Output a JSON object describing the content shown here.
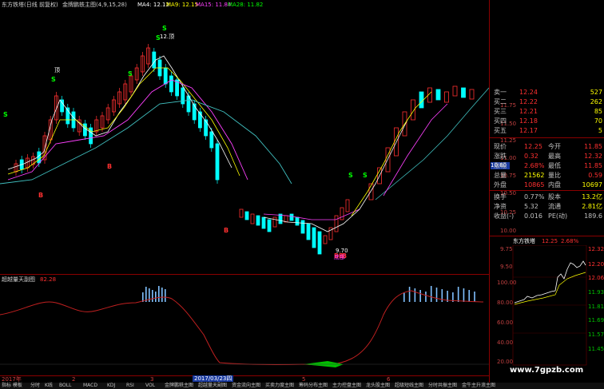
{
  "header": {
    "title": "东方铁塔(日线 前复权)",
    "indicator_name": "金牌鹏轶主图(4,9,15,28)",
    "ma4": "MA4: 12.12",
    "ma9": "MA9: 12.15",
    "ma15": "MA15: 11.84",
    "ma28": "MA28: 11.82"
  },
  "main_chart": {
    "annotations": {
      "top_label": "12.顶",
      "left_label": "顶",
      "low_label": "9.70",
      "low_bottom": "底部",
      "price_flag": "10.80"
    },
    "s_marks": [
      "S",
      "S",
      "S",
      "S",
      "S",
      "S",
      "S"
    ],
    "b_marks": [
      "B",
      "B",
      "B",
      "B",
      "B",
      "B"
    ],
    "price_ticks": [
      "11.75",
      "11.50",
      "11.25",
      "11.00",
      "10.75",
      "10.50",
      "10.25",
      "10.00",
      "9.75",
      "9.50"
    ]
  },
  "sub_chart": {
    "name": "超越量天副图",
    "value": "82.28",
    "ticks": [
      "100.00",
      "80.00",
      "60.00",
      "40.00",
      "20.00"
    ]
  },
  "order_book": {
    "rows": [
      {
        "label": "卖一",
        "price": "12.24",
        "vol": "527"
      },
      {
        "label": "买二",
        "price": "12.22",
        "vol": "262"
      },
      {
        "label": "买三",
        "price": "12.21",
        "vol": "85"
      },
      {
        "label": "买四",
        "price": "12.18",
        "vol": "70"
      },
      {
        "label": "买五",
        "price": "12.17",
        "vol": "5"
      }
    ]
  },
  "quote": {
    "rows": [
      {
        "l1": "现价",
        "v1": "12.25",
        "l2": "今开",
        "v2": "11.85"
      },
      {
        "l1": "涨跌",
        "v1": "0.32",
        "l2": "最高",
        "v2": "12.32"
      },
      {
        "l1": "涨幅",
        "v1": "2.68%",
        "l2": "最低",
        "v2": "11.85"
      },
      {
        "l1": "总量",
        "v1": "21562",
        "l2": "量比",
        "v2": "0.59"
      },
      {
        "l1": "外盘",
        "v1": "10865",
        "l2": "内盘",
        "v2": "10697"
      },
      {
        "l1": "换手",
        "v1": "0.77%",
        "l2": "股本",
        "v2": "13.2亿"
      },
      {
        "l1": "净资",
        "v1": "5.32",
        "l2": "流通",
        "v2": "2.81亿"
      },
      {
        "l1": "收益(-)",
        "v1": "0.016",
        "l2": "PE(动)",
        "v2": "189.6"
      }
    ]
  },
  "mini_chart": {
    "title": "东方铁塔",
    "price": "12.25",
    "pct": "2.68%",
    "right_ticks": [
      "12.32",
      "12.20",
      "12.06",
      "11.93",
      "11.81",
      "11.69",
      "11.57",
      "11.45"
    ]
  },
  "timeline": {
    "labels": [
      "2017年",
      "2",
      "3",
      "2017/03/23四",
      "5",
      "6"
    ]
  },
  "tabs": [
    "指标 模板",
    "分时",
    "K线",
    "BOLL",
    "MACD",
    "KDJ",
    "RSI",
    "VOL",
    "金牌鹏轶主图",
    "超越量天副图",
    "资金流向主图",
    "买卖力度主图",
    "筹码分布主图",
    "主力控盘主图",
    "龙头股主图",
    "超级短线主图",
    "分时共振主图",
    "金牛主升浪主图"
  ],
  "watermark": "www.7gpzb.com",
  "colors": {
    "up": "#ff3030",
    "down": "#00ffff",
    "ma4": "#ffffff",
    "ma9": "#ffff00",
    "ma15": "#ff40ff",
    "ma28": "#00ff00",
    "separator": "#8a0000"
  }
}
